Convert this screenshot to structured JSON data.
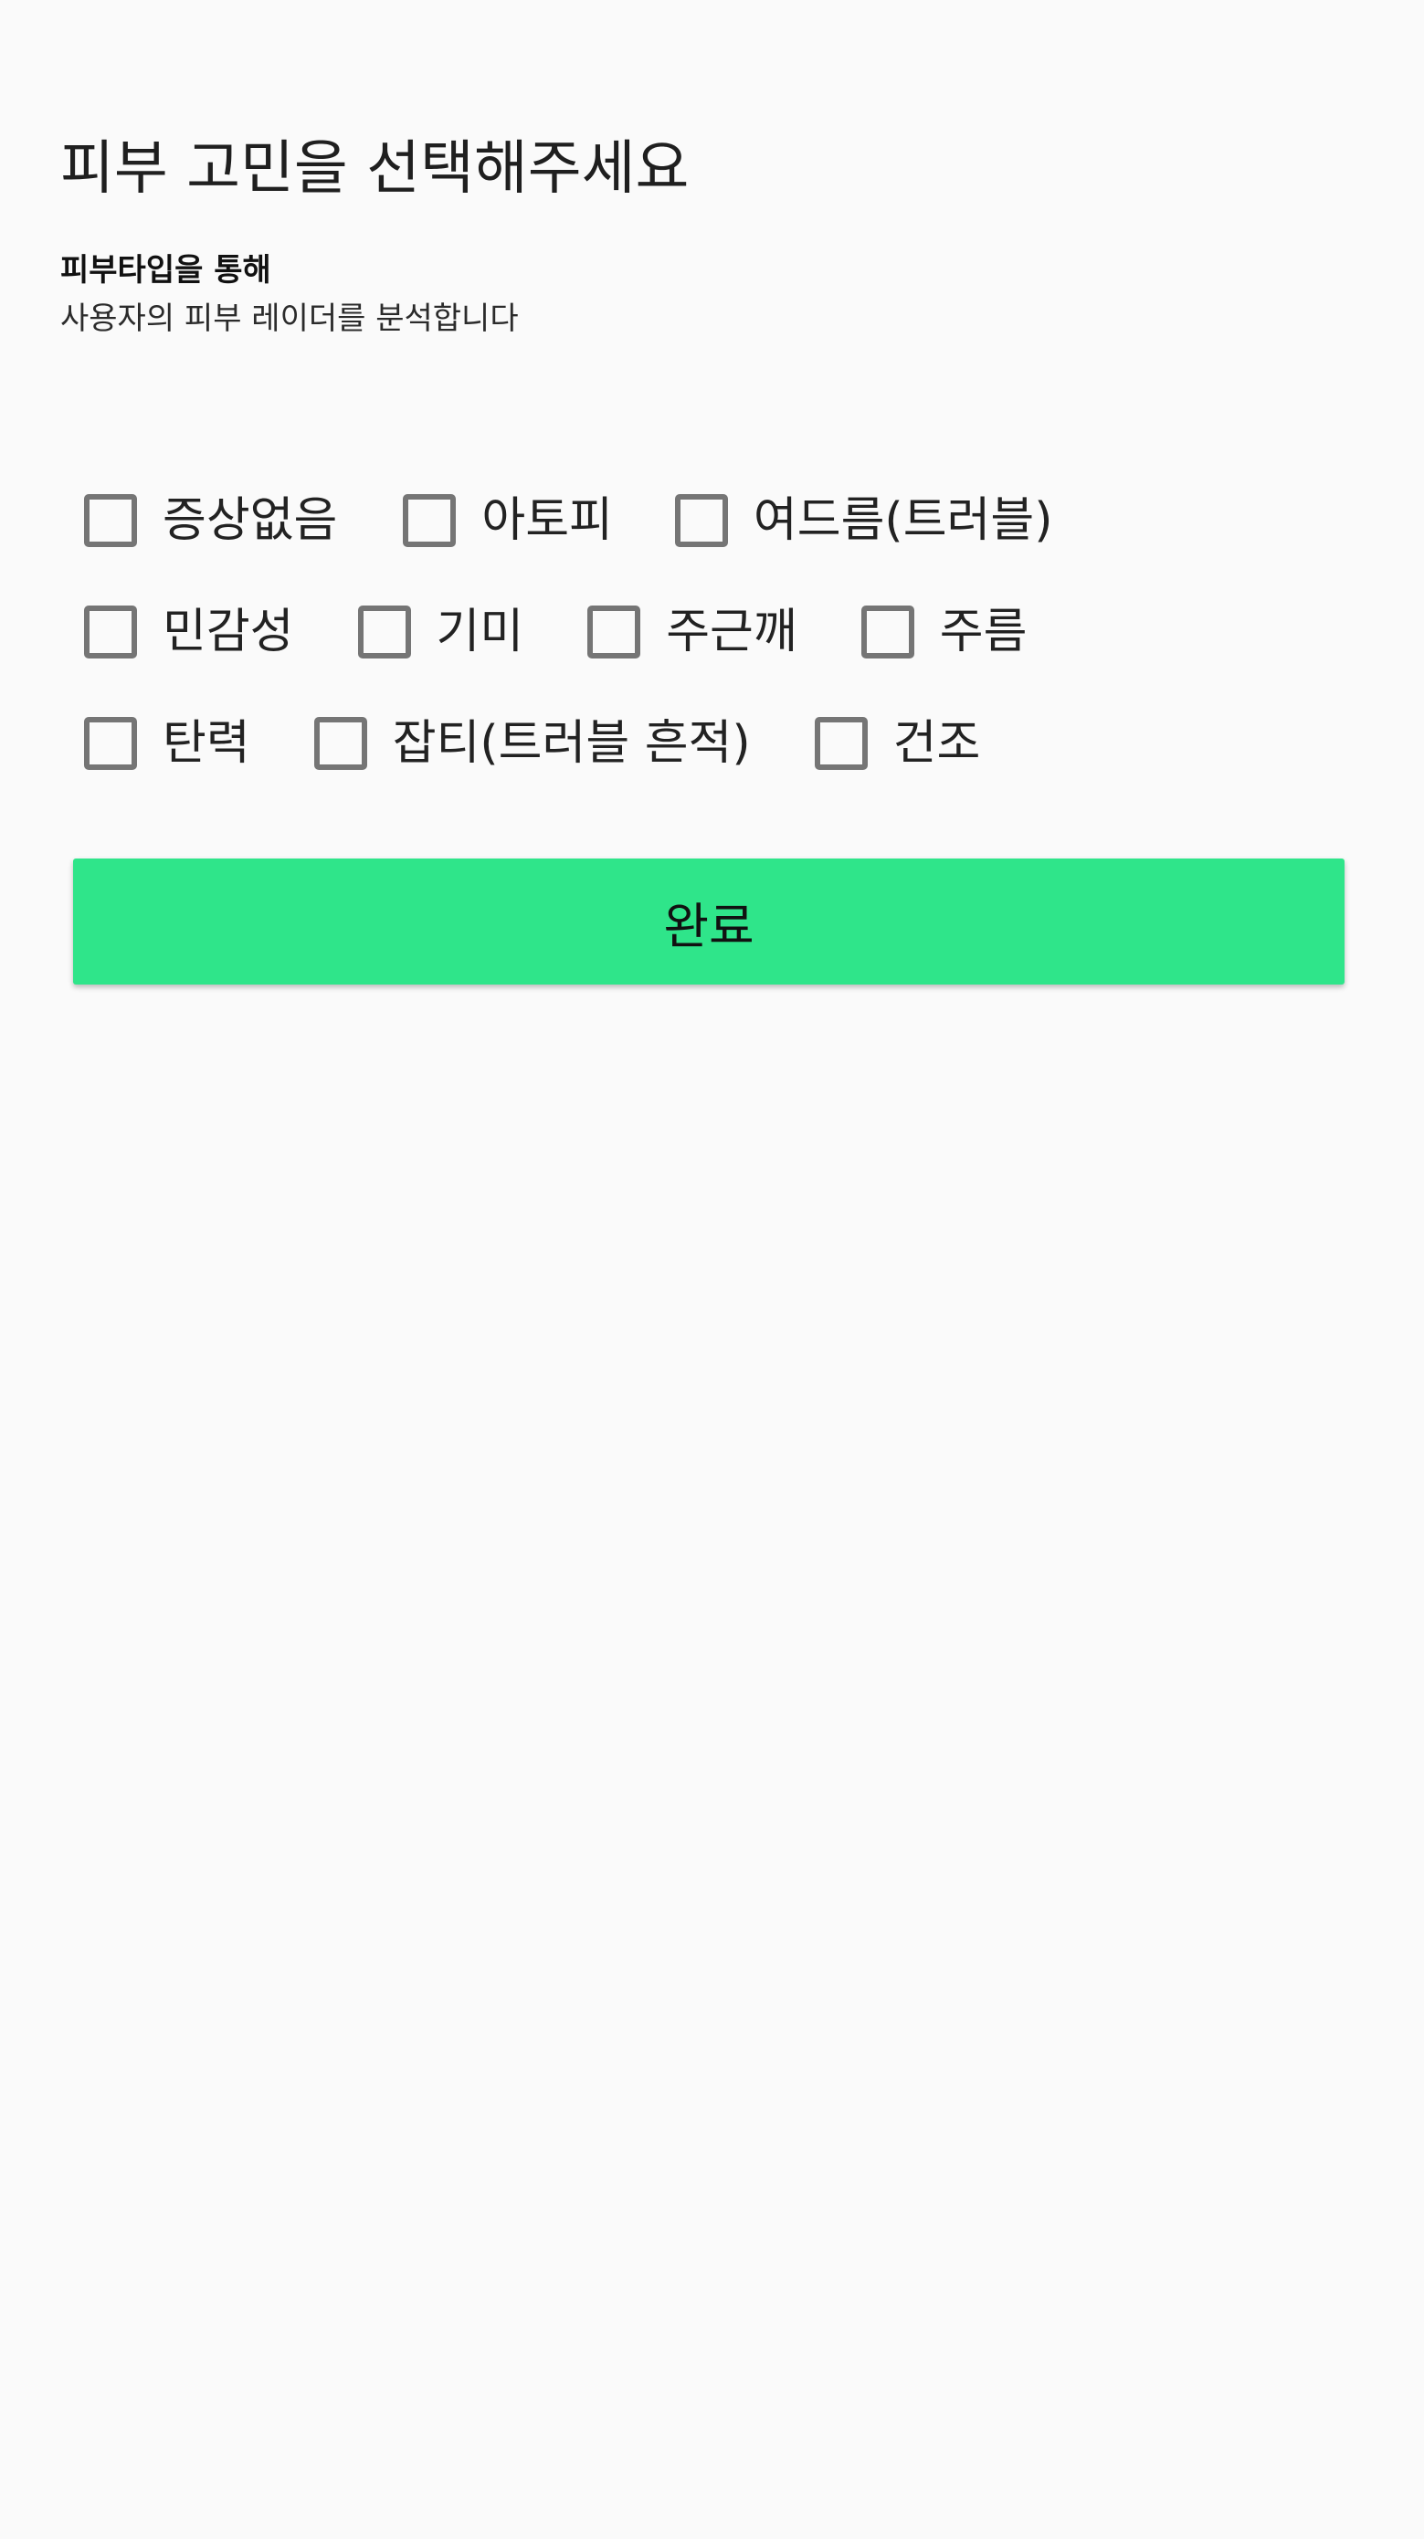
{
  "header": {
    "title": "피부 고민을 선택해주세요",
    "subtitle_line1": "피부타입을 통해",
    "subtitle_line2": "사용자의 피부 레이더를 분석합니다"
  },
  "concerns": {
    "row1": [
      "증상없음",
      "아토피",
      "여드름(트러블)"
    ],
    "row2": [
      "민감성",
      "기미",
      "주근깨",
      "주름"
    ],
    "row3": [
      "탄력",
      "잡티(트러블 흔적)",
      "건조"
    ]
  },
  "selected": [],
  "colors": {
    "background": "#fafafa",
    "accent": "#2fe58a",
    "checkbox_border": "#757575"
  },
  "done_button": {
    "label": "완료"
  }
}
